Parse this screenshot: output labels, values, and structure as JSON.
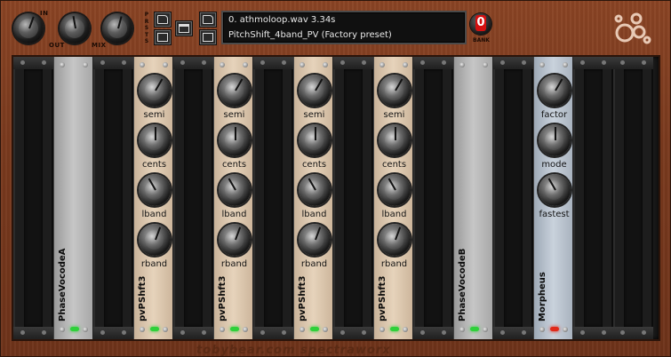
{
  "header": {
    "knob_labels": {
      "in": "IN",
      "out": "OUT",
      "mix": "MIX"
    },
    "presets_label": "PRSTS",
    "display": {
      "line1": "0. athmoloop.wav 3.34s",
      "line2": "PitchShift_4band_PV (Factory preset)"
    },
    "bank": {
      "number": "0",
      "label": "BANK"
    },
    "icons": [
      "open-folder-icon",
      "save-icon",
      "window-icon",
      "open-folder-icon",
      "export-icon",
      "logo-circles-icon"
    ]
  },
  "modules": [
    {
      "name": "PhaseVocodeA",
      "panel": "gray",
      "params": [],
      "led": "#2fd03a"
    },
    {
      "name": "pvPShft3",
      "panel": "tan",
      "params": [
        "semi",
        "cents",
        "lband",
        "rband"
      ],
      "led": "#2fd03a"
    },
    {
      "name": "pvPShft3",
      "panel": "tan",
      "params": [
        "semi",
        "cents",
        "lband",
        "rband"
      ],
      "led": "#2fd03a"
    },
    {
      "name": "pvPShft3",
      "panel": "tan",
      "params": [
        "semi",
        "cents",
        "lband",
        "rband"
      ],
      "led": "#2fd03a"
    },
    {
      "name": "pvPShft3",
      "panel": "tan",
      "params": [
        "semi",
        "cents",
        "lband",
        "rband"
      ],
      "led": "#2fd03a"
    },
    {
      "name": "PhaseVocodeB",
      "panel": "gray",
      "params": [],
      "led": "#2fd03a"
    },
    {
      "name": "Morpheus",
      "panel": "blue",
      "params": [
        "factor",
        "mode",
        "fastest"
      ],
      "led": "#e02a1a"
    }
  ],
  "footer": {
    "text": "tobybear.com spectraworx"
  },
  "colors": {
    "wood": "#7a3a1e",
    "display_bg": "#101010",
    "bank_red": "#d41010"
  }
}
